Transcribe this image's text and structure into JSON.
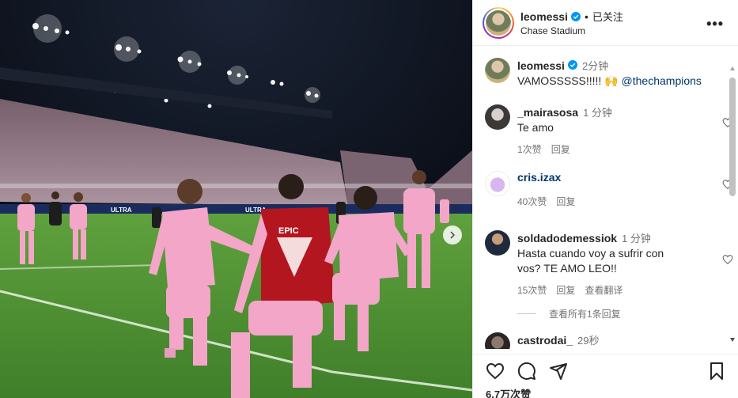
{
  "header": {
    "username": "leomessi",
    "separator": "•",
    "follow_status": "已关注",
    "location": "Chase Stadium",
    "more_label": "•••"
  },
  "caption": {
    "username": "leomessi",
    "time": "2分钟",
    "text": "VAMOSSSSS!!!!! 🙌",
    "mention": "@thechampions"
  },
  "comments": [
    {
      "username": "_mairasosa",
      "time": "1 分钟",
      "text": "Te amo",
      "likes": "1次赞",
      "reply": "回复",
      "translate": ""
    },
    {
      "username": "cris.izax",
      "time": "",
      "text": "",
      "likes": "40次赞",
      "reply": "回复",
      "translate": ""
    },
    {
      "username": "soldadodemessiok",
      "time": "1 分钟",
      "text": "Hasta cuando voy a sufrir con vos? TE AMO LEO!!",
      "likes": "15次赞",
      "reply": "回复",
      "translate": "查看翻译"
    },
    {
      "username": "castrodai_",
      "time": "29秒",
      "text": "",
      "likes": "",
      "reply": "",
      "translate": ""
    }
  ],
  "view_replies": "查看所有1条回复",
  "footer": {
    "likes_count": "6.7万次赞"
  },
  "photo": {
    "banner_text": "ULTRA"
  },
  "colors": {
    "verified": "#0095f6",
    "pink_kit": "#f4a6c9",
    "text": "#262626",
    "secondary": "#737373"
  }
}
